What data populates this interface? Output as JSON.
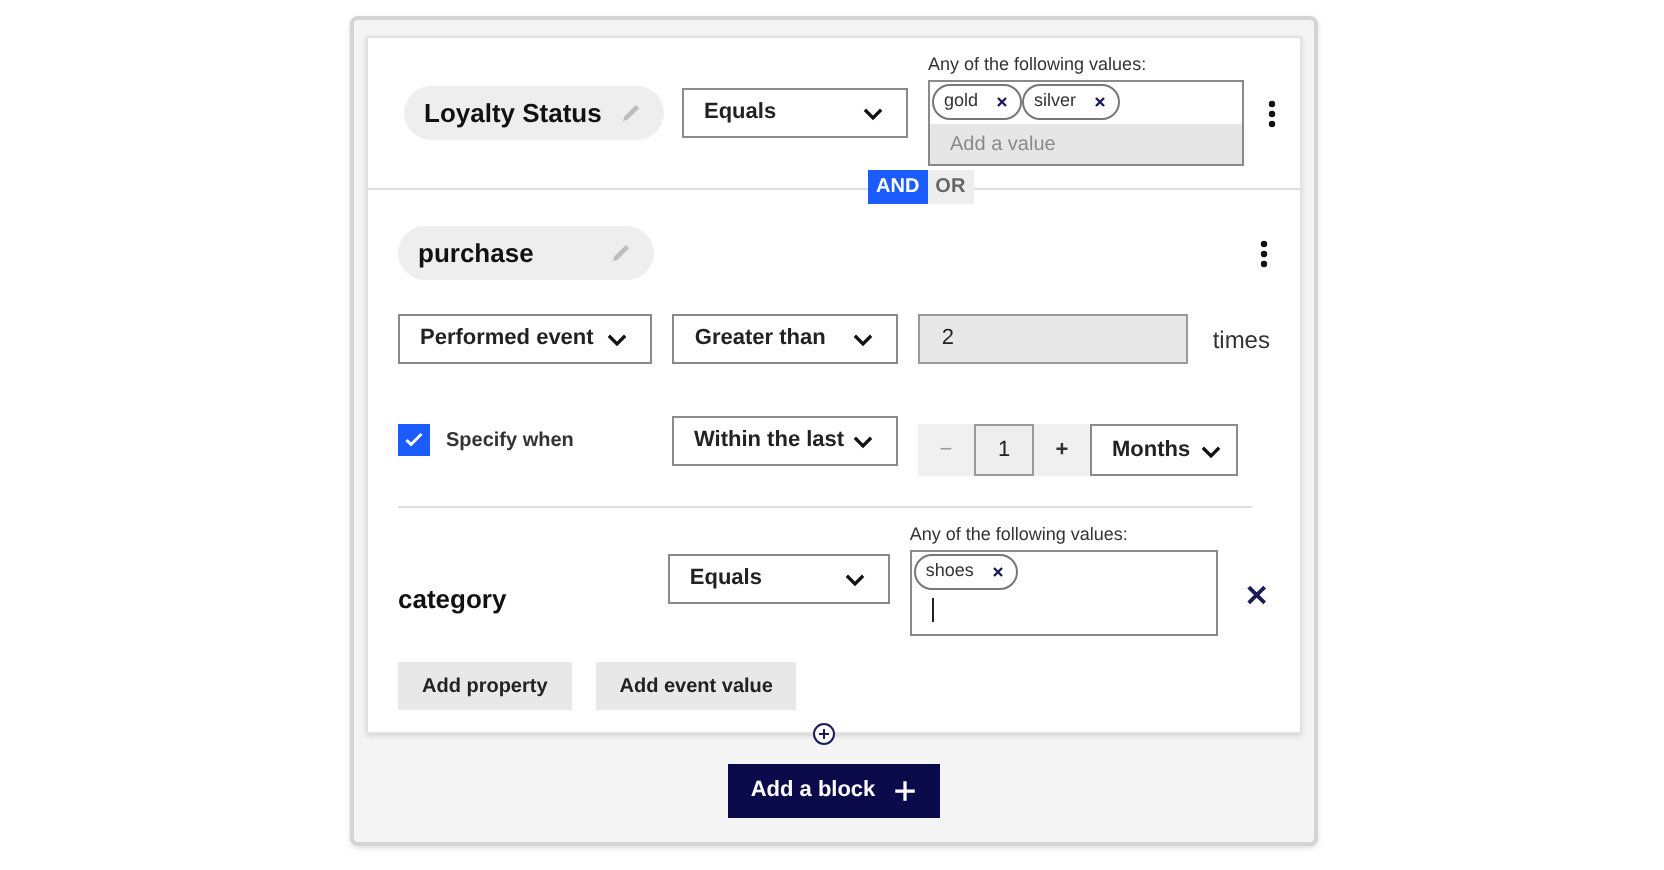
{
  "condition": {
    "property": "Loyalty Status",
    "operator": "Equals",
    "values_label": "Any of the following values:",
    "values": [
      "gold",
      "silver"
    ],
    "placeholder": "Add a value"
  },
  "logic_toggle": [
    {
      "label": "AND",
      "selected": true
    },
    {
      "label": "OR",
      "selected": false
    }
  ],
  "event": {
    "name": "purchase",
    "action": "Performed event",
    "operator": "Greater than",
    "count": "2",
    "count_unit": "times",
    "specify_when": {
      "label": "Specify when",
      "checked": true
    },
    "timeframe": "Within the last",
    "stepper": {
      "minus": "−",
      "value": "1",
      "plus": "+"
    },
    "period": "Months"
  },
  "event_property": {
    "name": "category",
    "operator": "Equals",
    "values_label": "Any of the following values:",
    "values": [
      "shoes"
    ]
  },
  "buttons": [
    "Add property",
    "Add event value"
  ],
  "add_block": "Add a block"
}
